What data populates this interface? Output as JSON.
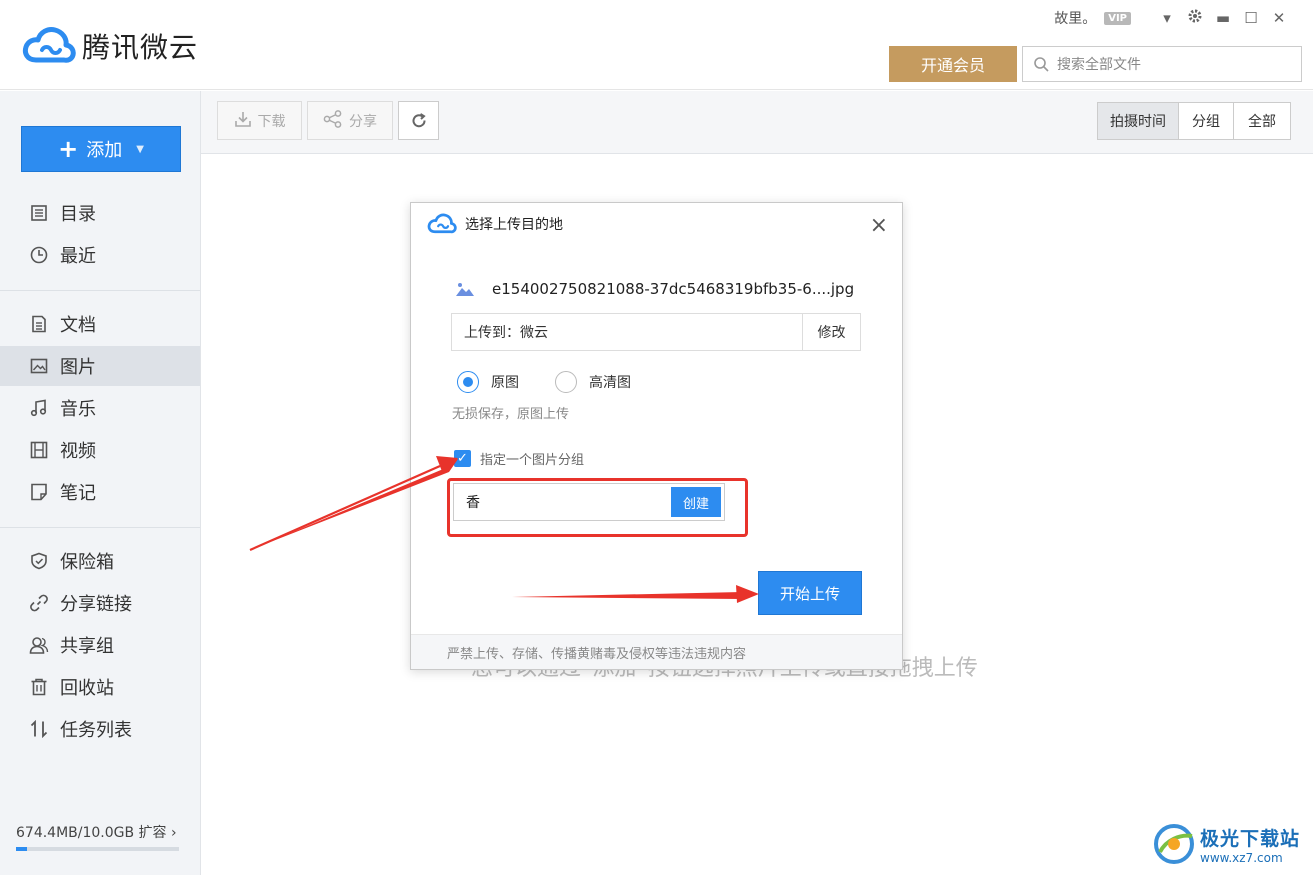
{
  "header": {
    "app_name": "腾讯微云",
    "user_name": "故里。",
    "vip_badge": "VIP",
    "vip_button_label": "开通会员",
    "search_placeholder": "搜索全部文件"
  },
  "sidebar": {
    "add_button_label": "添加",
    "group1": [
      {
        "label": "目录",
        "icon": "list-icon"
      },
      {
        "label": "最近",
        "icon": "clock-icon"
      }
    ],
    "group2": [
      {
        "label": "文档",
        "icon": "document-icon"
      },
      {
        "label": "图片",
        "icon": "image-icon",
        "active": true
      },
      {
        "label": "音乐",
        "icon": "music-icon"
      },
      {
        "label": "视频",
        "icon": "video-icon"
      },
      {
        "label": "笔记",
        "icon": "note-icon"
      }
    ],
    "group3": [
      {
        "label": "保险箱",
        "icon": "shield-icon"
      },
      {
        "label": "分享链接",
        "icon": "link-icon"
      },
      {
        "label": "共享组",
        "icon": "users-icon"
      },
      {
        "label": "回收站",
        "icon": "trash-icon"
      },
      {
        "label": "任务列表",
        "icon": "transfer-icon"
      }
    ],
    "storage_text": "674.4MB/10.0GB 扩容 ›",
    "storage_used_fraction": 0.066
  },
  "toolbar": {
    "download_label": "下载",
    "share_label": "分享",
    "view_options": [
      "拍摄时间",
      "分组",
      "全部"
    ],
    "active_view": "拍摄时间"
  },
  "main": {
    "empty_hint": "您可以通过“添加”按钮选择照片上传或直接拖拽上传"
  },
  "dialog": {
    "title": "选择上传目的地",
    "file_name": "e154002750821088-37dc5468319bfb35-6....jpg",
    "upload_to_label": "上传到：微云",
    "modify_label": "修改",
    "radio_original": "原图",
    "radio_hd": "高清图",
    "quality_selected": "原图",
    "quality_desc": "无损保存，原图上传",
    "group_checkbox_label": "指定一个图片分组",
    "group_checked": true,
    "group_input_value": "香",
    "create_label": "创建",
    "start_upload_label": "开始上传",
    "footer_note": "严禁上传、存储、传播黄赌毒及侵权等违法违规内容"
  },
  "watermark": {
    "title": "极光下载站",
    "url": "www.xz7.com"
  },
  "colors": {
    "accent": "#2d8cf0",
    "vip_gold": "#c59b5f",
    "annotation_red": "#e8332b"
  }
}
